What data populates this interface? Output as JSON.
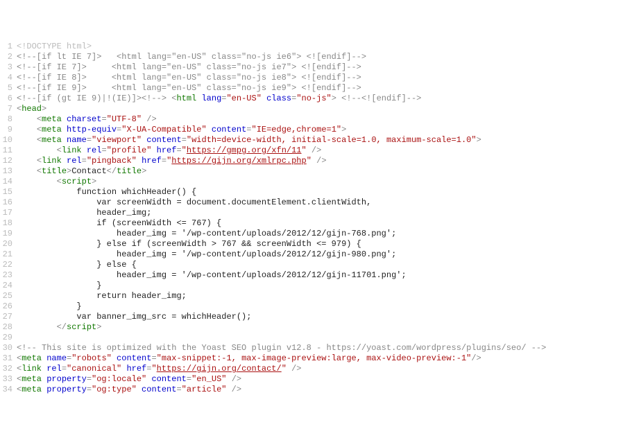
{
  "lines": [
    {
      "n": 1,
      "tokens": [
        {
          "t": "<!DOCTYPE html>",
          "c": "doctype"
        }
      ]
    },
    {
      "n": 2,
      "tokens": [
        {
          "t": "<!--[if lt IE 7]>   <html lang=\"en-US\" class=\"no-js ie6\"> <![endif]-->",
          "c": "comment"
        }
      ]
    },
    {
      "n": 3,
      "tokens": [
        {
          "t": "<!--[if IE 7]>     <html lang=\"en-US\" class=\"no-js ie7\"> <![endif]-->",
          "c": "comment"
        }
      ]
    },
    {
      "n": 4,
      "tokens": [
        {
          "t": "<!--[if IE 8]>     <html lang=\"en-US\" class=\"no-js ie8\"> <![endif]-->",
          "c": "comment"
        }
      ]
    },
    {
      "n": 5,
      "tokens": [
        {
          "t": "<!--[if IE 9]>     <html lang=\"en-US\" class=\"no-js ie9\"> <![endif]-->",
          "c": "comment"
        }
      ]
    },
    {
      "n": 6,
      "tokens": [
        {
          "t": "<!--[if (gt IE 9)|!(IE)]><!-->",
          "c": "comment"
        },
        {
          "t": " ",
          "c": "text"
        },
        {
          "t": "<",
          "c": "tag-bracket"
        },
        {
          "t": "html",
          "c": "tag-name"
        },
        {
          "t": " ",
          "c": "text"
        },
        {
          "t": "lang",
          "c": "attr-name"
        },
        {
          "t": "=",
          "c": "attr-eq"
        },
        {
          "t": "\"en-US\"",
          "c": "attr-val"
        },
        {
          "t": " ",
          "c": "text"
        },
        {
          "t": "class",
          "c": "attr-name"
        },
        {
          "t": "=",
          "c": "attr-eq"
        },
        {
          "t": "\"no-js\"",
          "c": "attr-val"
        },
        {
          "t": ">",
          "c": "tag-bracket"
        },
        {
          "t": " ",
          "c": "text"
        },
        {
          "t": "<!--<![endif]-->",
          "c": "comment"
        }
      ]
    },
    {
      "n": 7,
      "tokens": [
        {
          "t": "<",
          "c": "tag-bracket"
        },
        {
          "t": "head",
          "c": "tag-name"
        },
        {
          "t": ">",
          "c": "tag-bracket"
        }
      ]
    },
    {
      "n": 8,
      "tokens": [
        {
          "t": "    ",
          "c": "text"
        },
        {
          "t": "<",
          "c": "tag-bracket"
        },
        {
          "t": "meta",
          "c": "tag-name"
        },
        {
          "t": " ",
          "c": "text"
        },
        {
          "t": "charset",
          "c": "attr-name"
        },
        {
          "t": "=",
          "c": "attr-eq"
        },
        {
          "t": "\"UTF-8\"",
          "c": "attr-val"
        },
        {
          "t": " />",
          "c": "tag-bracket"
        }
      ]
    },
    {
      "n": 9,
      "tokens": [
        {
          "t": "    ",
          "c": "text"
        },
        {
          "t": "<",
          "c": "tag-bracket"
        },
        {
          "t": "meta",
          "c": "tag-name"
        },
        {
          "t": " ",
          "c": "text"
        },
        {
          "t": "http-equiv",
          "c": "attr-name"
        },
        {
          "t": "=",
          "c": "attr-eq"
        },
        {
          "t": "\"X-UA-Compatible\"",
          "c": "attr-val"
        },
        {
          "t": " ",
          "c": "text"
        },
        {
          "t": "content",
          "c": "attr-name"
        },
        {
          "t": "=",
          "c": "attr-eq"
        },
        {
          "t": "\"IE=edge,chrome=1\"",
          "c": "attr-val"
        },
        {
          "t": ">",
          "c": "tag-bracket"
        }
      ]
    },
    {
      "n": 10,
      "tokens": [
        {
          "t": "    ",
          "c": "text"
        },
        {
          "t": "<",
          "c": "tag-bracket"
        },
        {
          "t": "meta",
          "c": "tag-name"
        },
        {
          "t": " ",
          "c": "text"
        },
        {
          "t": "name",
          "c": "attr-name"
        },
        {
          "t": "=",
          "c": "attr-eq"
        },
        {
          "t": "\"viewport\"",
          "c": "attr-val"
        },
        {
          "t": " ",
          "c": "text"
        },
        {
          "t": "content",
          "c": "attr-name"
        },
        {
          "t": "=",
          "c": "attr-eq"
        },
        {
          "t": "\"width=device-width, initial-scale=1.0, maximum-scale=1.0\"",
          "c": "attr-val"
        },
        {
          "t": ">",
          "c": "tag-bracket"
        }
      ]
    },
    {
      "n": 11,
      "tokens": [
        {
          "t": "        ",
          "c": "text"
        },
        {
          "t": "<",
          "c": "tag-bracket"
        },
        {
          "t": "link",
          "c": "tag-name"
        },
        {
          "t": " ",
          "c": "text"
        },
        {
          "t": "rel",
          "c": "attr-name"
        },
        {
          "t": "=",
          "c": "attr-eq"
        },
        {
          "t": "\"profile\"",
          "c": "attr-val"
        },
        {
          "t": " ",
          "c": "text"
        },
        {
          "t": "href",
          "c": "attr-name"
        },
        {
          "t": "=",
          "c": "attr-eq"
        },
        {
          "t": "\"",
          "c": "attr-val"
        },
        {
          "t": "https://gmpg.org/xfn/11",
          "c": "link"
        },
        {
          "t": "\"",
          "c": "attr-val"
        },
        {
          "t": " />",
          "c": "tag-bracket"
        }
      ]
    },
    {
      "n": 12,
      "tokens": [
        {
          "t": "    ",
          "c": "text"
        },
        {
          "t": "<",
          "c": "tag-bracket"
        },
        {
          "t": "link",
          "c": "tag-name"
        },
        {
          "t": " ",
          "c": "text"
        },
        {
          "t": "rel",
          "c": "attr-name"
        },
        {
          "t": "=",
          "c": "attr-eq"
        },
        {
          "t": "\"pingback\"",
          "c": "attr-val"
        },
        {
          "t": " ",
          "c": "text"
        },
        {
          "t": "href",
          "c": "attr-name"
        },
        {
          "t": "=",
          "c": "attr-eq"
        },
        {
          "t": "\"",
          "c": "attr-val"
        },
        {
          "t": "https://gijn.org/xmlrpc.php",
          "c": "link"
        },
        {
          "t": "\"",
          "c": "attr-val"
        },
        {
          "t": " />",
          "c": "tag-bracket"
        }
      ]
    },
    {
      "n": 13,
      "tokens": [
        {
          "t": "    ",
          "c": "text"
        },
        {
          "t": "<",
          "c": "tag-bracket"
        },
        {
          "t": "title",
          "c": "tag-name"
        },
        {
          "t": ">",
          "c": "tag-bracket"
        },
        {
          "t": "Contact",
          "c": "text"
        },
        {
          "t": "</",
          "c": "tag-bracket"
        },
        {
          "t": "title",
          "c": "tag-name"
        },
        {
          "t": ">",
          "c": "tag-bracket"
        }
      ]
    },
    {
      "n": 14,
      "tokens": [
        {
          "t": "        ",
          "c": "text"
        },
        {
          "t": "<",
          "c": "tag-bracket"
        },
        {
          "t": "script",
          "c": "tag-name"
        },
        {
          "t": ">",
          "c": "tag-bracket"
        }
      ]
    },
    {
      "n": 15,
      "tokens": [
        {
          "t": "            function whichHeader() {",
          "c": "text"
        }
      ]
    },
    {
      "n": 16,
      "tokens": [
        {
          "t": "                var screenWidth = document.documentElement.clientWidth,",
          "c": "text"
        }
      ]
    },
    {
      "n": 17,
      "tokens": [
        {
          "t": "                header_img;",
          "c": "text"
        }
      ]
    },
    {
      "n": 18,
      "tokens": [
        {
          "t": "                if (screenWidth <= 767) {",
          "c": "text"
        }
      ]
    },
    {
      "n": 19,
      "tokens": [
        {
          "t": "                    header_img = '/wp-content/uploads/2012/12/gijn-768.png';",
          "c": "text"
        }
      ]
    },
    {
      "n": 20,
      "tokens": [
        {
          "t": "                } else if (screenWidth > 767 && screenWidth <= 979) {",
          "c": "text"
        }
      ]
    },
    {
      "n": 21,
      "tokens": [
        {
          "t": "                    header_img = '/wp-content/uploads/2012/12/gijn-980.png';",
          "c": "text"
        }
      ]
    },
    {
      "n": 22,
      "tokens": [
        {
          "t": "                } else {",
          "c": "text"
        }
      ]
    },
    {
      "n": 23,
      "tokens": [
        {
          "t": "                    header_img = '/wp-content/uploads/2012/12/gijn-11701.png';",
          "c": "text"
        }
      ]
    },
    {
      "n": 24,
      "tokens": [
        {
          "t": "                }",
          "c": "text"
        }
      ]
    },
    {
      "n": 25,
      "tokens": [
        {
          "t": "                return header_img;",
          "c": "text"
        }
      ]
    },
    {
      "n": 26,
      "tokens": [
        {
          "t": "            }",
          "c": "text"
        }
      ]
    },
    {
      "n": 27,
      "tokens": [
        {
          "t": "            var banner_img_src = whichHeader();",
          "c": "text"
        }
      ]
    },
    {
      "n": 28,
      "tokens": [
        {
          "t": "        ",
          "c": "text"
        },
        {
          "t": "</",
          "c": "tag-bracket"
        },
        {
          "t": "script",
          "c": "tag-name"
        },
        {
          "t": ">",
          "c": "tag-bracket"
        }
      ]
    },
    {
      "n": 29,
      "tokens": [
        {
          "t": "",
          "c": "text"
        }
      ]
    },
    {
      "n": 30,
      "tokens": [
        {
          "t": "<!-- This site is optimized with the Yoast SEO plugin v12.8 - https://yoast.com/wordpress/plugins/seo/ -->",
          "c": "comment"
        }
      ]
    },
    {
      "n": 31,
      "tokens": [
        {
          "t": "<",
          "c": "tag-bracket"
        },
        {
          "t": "meta",
          "c": "tag-name"
        },
        {
          "t": " ",
          "c": "text"
        },
        {
          "t": "name",
          "c": "attr-name"
        },
        {
          "t": "=",
          "c": "attr-eq"
        },
        {
          "t": "\"robots\"",
          "c": "attr-val"
        },
        {
          "t": " ",
          "c": "text"
        },
        {
          "t": "content",
          "c": "attr-name"
        },
        {
          "t": "=",
          "c": "attr-eq"
        },
        {
          "t": "\"max-snippet:-1, max-image-preview:large, max-video-preview:-1\"",
          "c": "attr-val"
        },
        {
          "t": "/>",
          "c": "tag-bracket"
        }
      ]
    },
    {
      "n": 32,
      "tokens": [
        {
          "t": "<",
          "c": "tag-bracket"
        },
        {
          "t": "link",
          "c": "tag-name"
        },
        {
          "t": " ",
          "c": "text"
        },
        {
          "t": "rel",
          "c": "attr-name"
        },
        {
          "t": "=",
          "c": "attr-eq"
        },
        {
          "t": "\"canonical\"",
          "c": "attr-val"
        },
        {
          "t": " ",
          "c": "text"
        },
        {
          "t": "href",
          "c": "attr-name"
        },
        {
          "t": "=",
          "c": "attr-eq"
        },
        {
          "t": "\"",
          "c": "attr-val"
        },
        {
          "t": "https://gijn.org/contact/",
          "c": "link"
        },
        {
          "t": "\"",
          "c": "attr-val"
        },
        {
          "t": " />",
          "c": "tag-bracket"
        }
      ]
    },
    {
      "n": 33,
      "tokens": [
        {
          "t": "<",
          "c": "tag-bracket"
        },
        {
          "t": "meta",
          "c": "tag-name"
        },
        {
          "t": " ",
          "c": "text"
        },
        {
          "t": "property",
          "c": "attr-name"
        },
        {
          "t": "=",
          "c": "attr-eq"
        },
        {
          "t": "\"og:locale\"",
          "c": "attr-val"
        },
        {
          "t": " ",
          "c": "text"
        },
        {
          "t": "content",
          "c": "attr-name"
        },
        {
          "t": "=",
          "c": "attr-eq"
        },
        {
          "t": "\"en_US\"",
          "c": "attr-val"
        },
        {
          "t": " />",
          "c": "tag-bracket"
        }
      ]
    },
    {
      "n": 34,
      "tokens": [
        {
          "t": "<",
          "c": "tag-bracket"
        },
        {
          "t": "meta",
          "c": "tag-name"
        },
        {
          "t": " ",
          "c": "text"
        },
        {
          "t": "property",
          "c": "attr-name"
        },
        {
          "t": "=",
          "c": "attr-eq"
        },
        {
          "t": "\"og:type\"",
          "c": "attr-val"
        },
        {
          "t": " ",
          "c": "text"
        },
        {
          "t": "content",
          "c": "attr-name"
        },
        {
          "t": "=",
          "c": "attr-eq"
        },
        {
          "t": "\"article\"",
          "c": "attr-val"
        },
        {
          "t": " />",
          "c": "tag-bracket"
        }
      ]
    }
  ]
}
